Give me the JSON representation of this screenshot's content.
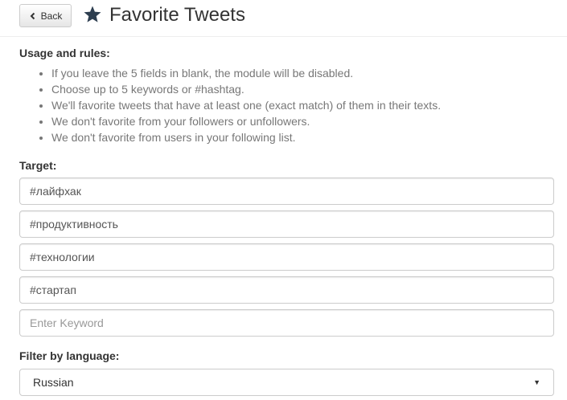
{
  "header": {
    "back_label": "Back",
    "title": "Favorite Tweets"
  },
  "usage": {
    "heading": "Usage and rules:",
    "rules": [
      "If you leave the 5 fields in blank, the module will be disabled.",
      "Choose up to 5 keywords or #hashtag.",
      "We'll favorite tweets that have at least one (exact match) of them in their texts.",
      "We don't favorite from your followers or unfollowers.",
      "We don't favorite from users in your following list."
    ]
  },
  "target": {
    "heading": "Target:",
    "keywords": [
      {
        "value": "#лайфхак",
        "placeholder": ""
      },
      {
        "value": "#продуктивность",
        "placeholder": ""
      },
      {
        "value": "#технологии",
        "placeholder": ""
      },
      {
        "value": "#стартап",
        "placeholder": ""
      },
      {
        "value": "",
        "placeholder": "Enter Keyword"
      }
    ]
  },
  "language_filter": {
    "heading": "Filter by language:",
    "selected": "Russian"
  },
  "icons": {
    "back": "chevron-left-icon",
    "title": "star-icon",
    "select": "caret-down-icon"
  },
  "colors": {
    "title_star": "#2d3e50",
    "muted_text": "#777777",
    "border": "#cccccc"
  }
}
